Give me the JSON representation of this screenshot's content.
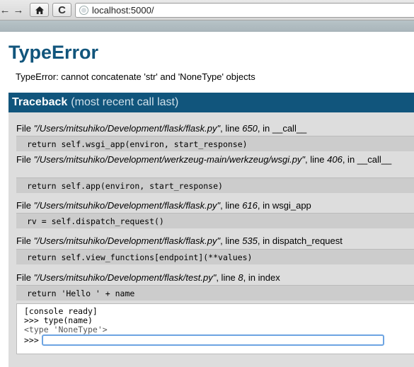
{
  "browser": {
    "back_icon": "←",
    "forward_icon": "→",
    "home_icon": "⌂",
    "reload_icon": "C",
    "url": "localhost:5000/"
  },
  "error": {
    "title": "TypeError",
    "message": "TypeError: cannot concatenate 'str' and 'NoneType' objects"
  },
  "traceback": {
    "header_strong": "Traceback",
    "header_sub": "(most recent call last)",
    "frames": [
      {
        "file": "\"/Users/mitsuhiko/Development/flask/flask.py\"",
        "line": "650",
        "func": "__call__",
        "code": "return self.wsgi_app(environ, start_response)"
      },
      {
        "file": "\"/Users/mitsuhiko/Development/werkzeug-main/werkzeug/wsgi.py\"",
        "line": "406",
        "func": "__call__",
        "code": "return self.app(environ, start_response)"
      },
      {
        "file": "\"/Users/mitsuhiko/Development/flask/flask.py\"",
        "line": "616",
        "func": "wsgi_app",
        "code": "rv = self.dispatch_request()"
      },
      {
        "file": "\"/Users/mitsuhiko/Development/flask/flask.py\"",
        "line": "535",
        "func": "dispatch_request",
        "code": "return self.view_functions[endpoint](**values)"
      },
      {
        "file": "\"/Users/mitsuhiko/Development/flask/test.py\"",
        "line": "8",
        "func": "index",
        "code": "return 'Hello ' + name"
      }
    ]
  },
  "console": {
    "ready": "[console ready]",
    "input": ">>> type(name)",
    "output": "<type 'NoneType'>",
    "prompt": ">>>",
    "value": ""
  },
  "labels": {
    "file": "File ",
    "line": ", line ",
    "in": ", in "
  }
}
